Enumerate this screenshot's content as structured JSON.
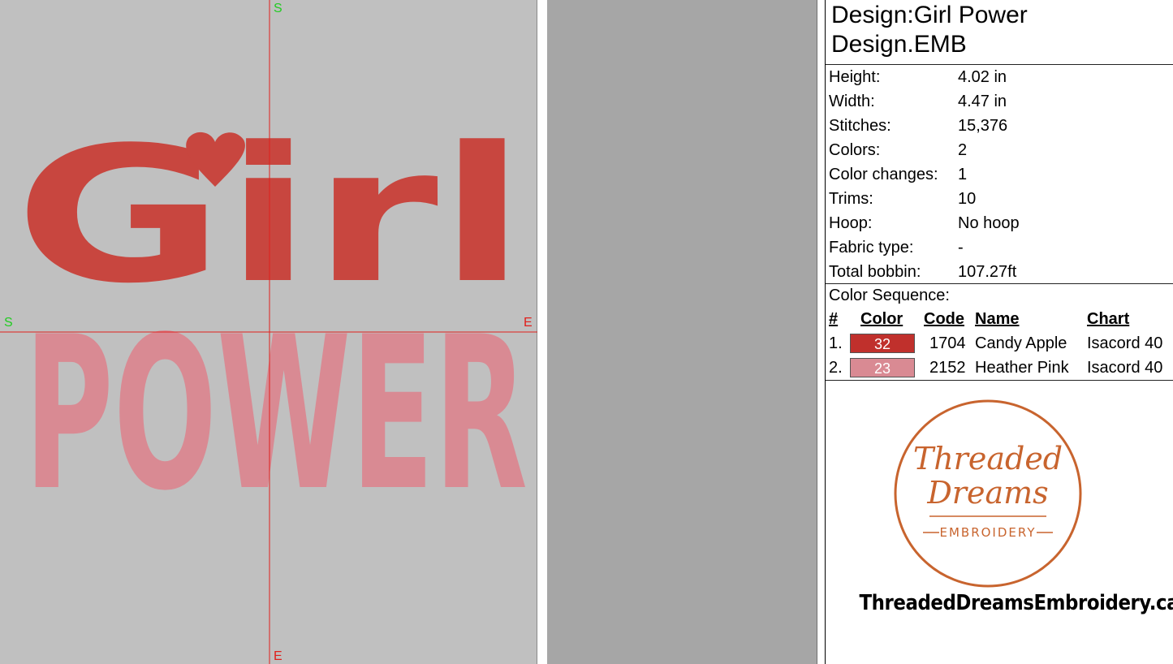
{
  "canvas": {
    "axis_labels": {
      "top": "S",
      "bottom": "E",
      "left": "S",
      "right": "E"
    },
    "design_lines": [
      {
        "text": "Girl",
        "color": "#c8463f"
      },
      {
        "text": "POWER",
        "color": "#d98a93"
      }
    ],
    "heart_color": "#c8463f"
  },
  "info": {
    "design_name_line": "Design:Girl Power",
    "file_name_line": "Design.EMB",
    "specs": [
      {
        "key": "Height:",
        "value": "4.02 in"
      },
      {
        "key": "Width:",
        "value": "4.47 in"
      },
      {
        "key": "Stitches:",
        "value": "15,376"
      },
      {
        "key": "Colors:",
        "value": "2"
      },
      {
        "key": "Color changes:",
        "value": "1"
      },
      {
        "key": "Trims:",
        "value": "10"
      },
      {
        "key": "Hoop:",
        "value": "No hoop"
      },
      {
        "key": "Fabric type:",
        "value": "-"
      },
      {
        "key": "Total bobbin:",
        "value": "107.27ft"
      }
    ],
    "color_sequence_title": "Color Sequence:",
    "table_headers": {
      "num": "#",
      "color": "Color",
      "code": "Code",
      "name": "Name",
      "chart": "Chart"
    },
    "color_rows": [
      {
        "num": "1.",
        "swatch_label": "32",
        "swatch_color": "#c0302c",
        "code": "1704",
        "name": "Candy Apple",
        "chart": "Isacord 40"
      },
      {
        "num": "2.",
        "swatch_label": "23",
        "swatch_color": "#d98a93",
        "code": "2152",
        "name": "Heather Pink",
        "chart": "Isacord 40"
      }
    ]
  },
  "logo": {
    "line1": "Threaded",
    "line2": "Dreams",
    "line3": "EMBROIDERY",
    "accent_color": "#c8642e"
  },
  "website": "ThreadedDreamsEmbroidery.ca"
}
